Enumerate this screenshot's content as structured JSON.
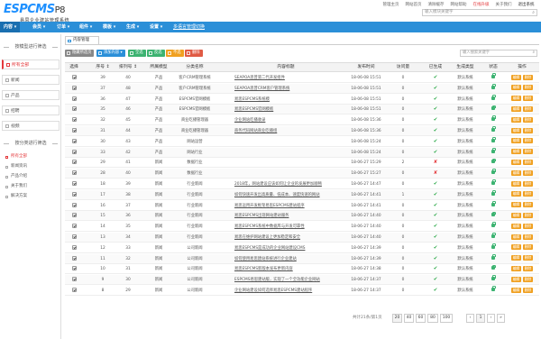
{
  "header": {
    "logo_text": "ESPCMS",
    "logo_version": "P8",
    "logo_subtitle": "易思企业建站管理系统",
    "top_links": [
      "管理主页",
      "网站首页",
      "清除缓存",
      "网站帮助",
      "在线升级",
      "关于我们",
      "退出系统"
    ],
    "search_placeholder": "输入模块关键字"
  },
  "nav": {
    "items": [
      "内容",
      "会员",
      "订单",
      "组件",
      "模板",
      "生成",
      "设置",
      "多语言管理切换"
    ],
    "arrows": "▾"
  },
  "sidebar": {
    "section1_title": "按模型进行筛选",
    "items": [
      "所有全部",
      "新闻",
      "产品",
      "招聘",
      "视频"
    ],
    "section2_title": "按分类进行筛选",
    "sub_items": [
      "所有全部",
      "新闻资讯",
      "产品介绍",
      "关于我们",
      "解决方案"
    ]
  },
  "main": {
    "tab_label": "内容管理",
    "toolbar": {
      "buttons": [
        "隐藏所选页",
        "添加内容",
        "全选",
        "反选",
        "不选",
        "删除"
      ],
      "search_placeholder": "输入搜索关键字"
    },
    "columns": [
      "选择",
      "序号",
      "排列号",
      "所属模型",
      "分类名称",
      "内容标题",
      "发布时间",
      "访问量",
      "已生成",
      "生成类型",
      "状态",
      "操作"
    ],
    "sort_marks": [
      "↕",
      "↕"
    ],
    "rows": [
      {
        "id": "39",
        "order": "40",
        "model": "产品",
        "cat": "客户CRM管理系统",
        "title": "SEAPOA思普第二代开发组件",
        "time": "18-06-08 15:51",
        "views": "0",
        "gen": "ok",
        "type": "默认系统"
      },
      {
        "id": "37",
        "order": "48",
        "model": "产品",
        "cat": "客户CRM管理系统",
        "title": "SEAPOA思普CRM客户管理系统",
        "time": "18-06-08 15:51",
        "views": "0",
        "gen": "ok",
        "type": "默认系统"
      },
      {
        "id": "36",
        "order": "47",
        "model": "产品",
        "cat": "ESPCMS官网模板",
        "title": "易思ESPCMS系统模",
        "time": "18-06-08 15:51",
        "views": "0",
        "gen": "ok",
        "type": "默认系统"
      },
      {
        "id": "35",
        "order": "46",
        "model": "产品",
        "cat": "ESPCMS官网模板",
        "title": "易思ESPCMS官网模板",
        "time": "18-06-08 15:51",
        "views": "0",
        "gen": "ok",
        "type": "默认系统"
      },
      {
        "id": "32",
        "order": "45",
        "model": "产品",
        "cat": "商业吃播管理器",
        "title": "企业网站吃播收录",
        "time": "18-06-08 15:36",
        "views": "0",
        "gen": "ok",
        "type": "默认系统"
      },
      {
        "id": "31",
        "order": "44",
        "model": "产品",
        "cat": "商业吃播管理器",
        "title": "商务代码网站商业吃播组",
        "time": "18-06-08 15:36",
        "views": "0",
        "gen": "ok",
        "type": "默认系统"
      },
      {
        "id": "30",
        "order": "43",
        "model": "产品",
        "cat": "网站运营",
        "title": "",
        "time": "18-06-08 15:24",
        "views": "0",
        "gen": "ok",
        "type": "默认系统"
      },
      {
        "id": "33",
        "order": "42",
        "model": "产品",
        "cat": "网站行业",
        "title": "",
        "time": "18-06-08 15:24",
        "views": "0",
        "gen": "ok",
        "type": "默认系统"
      },
      {
        "id": "29",
        "order": "41",
        "model": "新闻",
        "cat": "数据行业",
        "title": "",
        "time": "18-06-27 15:29",
        "views": "2",
        "gen": "no",
        "type": "默认系统"
      },
      {
        "id": "28",
        "order": "40",
        "model": "新闻",
        "cat": "数据行业",
        "title": "",
        "time": "18-06-27 15:27",
        "views": "0",
        "gen": "no",
        "type": "默认系统"
      },
      {
        "id": "18",
        "order": "39",
        "model": "新闻",
        "cat": "行业新闻",
        "title": "2018年，网站建设应该如何让企业的发展更加顺畅",
        "time": "18-06-27 14:47",
        "views": "0",
        "gen": "ok",
        "type": "默认系统"
      },
      {
        "id": "17",
        "order": "38",
        "model": "新闻",
        "cat": "行业新闻",
        "title": "如何快速开发出高质量、低成本、速度快速的网站",
        "time": "18-06-27 14:41",
        "views": "1",
        "gen": "ok",
        "type": "默认系统"
      },
      {
        "id": "16",
        "order": "37",
        "model": "新闻",
        "cat": "行业新闻",
        "title": "易思运用开发框架易思ESPCMS建站程序",
        "time": "18-06-27 14:41",
        "views": "0",
        "gen": "ok",
        "type": "默认系统"
      },
      {
        "id": "15",
        "order": "36",
        "model": "新闻",
        "cat": "行业新闻",
        "title": "易思ESPCMS出现网站建站服务",
        "time": "18-06-27 14:40",
        "views": "0",
        "gen": "ok",
        "type": "默认系统"
      },
      {
        "id": "14",
        "order": "35",
        "model": "新闻",
        "cat": "行业新闻",
        "title": "易思ESPCMS系统中数据库与开发可靠性",
        "time": "18-06-27 14:40",
        "views": "0",
        "gen": "ok",
        "type": "默认系统"
      },
      {
        "id": "13",
        "order": "34",
        "model": "新闻",
        "cat": "行业新闻",
        "title": "易思在维护网站建设上更加稳定和安全",
        "time": "18-06-27 14:40",
        "views": "0",
        "gen": "ok",
        "type": "默认系统"
      },
      {
        "id": "12",
        "order": "33",
        "model": "新闻",
        "cat": "公司新闻",
        "title": "易思ESPCMS是成功的企业网站建设CMS",
        "time": "18-06-27 14:39",
        "views": "0",
        "gen": "ok",
        "type": "默认系统"
      },
      {
        "id": "11",
        "order": "32",
        "model": "新闻",
        "cat": "公司新闻",
        "title": "如何使用易思建站系统进行企业建站",
        "time": "18-06-27 14:39",
        "views": "0",
        "gen": "ok",
        "type": "默认系统"
      },
      {
        "id": "10",
        "order": "31",
        "model": "新闻",
        "cat": "公司新闻",
        "title": "易思ESPCMS新版本发布更新内容",
        "time": "18-06-27 14:38",
        "views": "0",
        "gen": "ok",
        "type": "默认系统"
      },
      {
        "id": "9",
        "order": "30",
        "model": "新闻",
        "cat": "公司新闻",
        "title": "ESPCMS易思建站版，实现了一个全功能企业网站",
        "time": "18-06-27 14:37",
        "views": "0",
        "gen": "ok",
        "type": "默认系统"
      },
      {
        "id": "8",
        "order": "29",
        "model": "新闻",
        "cat": "公司新闻",
        "title": "企业网站建设如何选择易思ESPCMS建站程序",
        "time": "18-06-27 14:37",
        "views": "0",
        "gen": "ok",
        "type": "默认系统"
      }
    ],
    "op_labels": [
      "编辑",
      "删除"
    ],
    "pagination": {
      "total_text": "共计21条/第1页",
      "page_sizes": [
        "20",
        "40",
        "60",
        "80",
        "100"
      ],
      "prev": "‹",
      "current": "1",
      "next": "›",
      "last": "»"
    }
  },
  "colors": {
    "nav_blue": "#2b8fd8",
    "accent_red": "#e4393c",
    "ok_green": "#2eaa4a",
    "btn_orange": "#f0a020"
  }
}
